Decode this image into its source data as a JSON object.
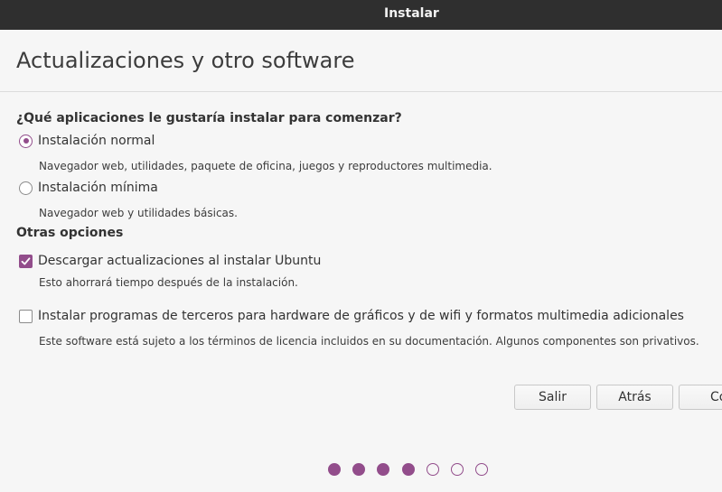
{
  "window": {
    "title": "Instalar"
  },
  "page": {
    "title": "Actualizaciones y otro software"
  },
  "apps_section": {
    "heading": "¿Qué aplicaciones le gustaría instalar para comenzar?",
    "options": [
      {
        "label": "Instalación normal",
        "description": "Navegador web, utilidades, paquete de oficina, juegos y reproductores multimedia.",
        "selected": true
      },
      {
        "label": "Instalación mínima",
        "description": "Navegador web y utilidades básicas.",
        "selected": false
      }
    ]
  },
  "other_section": {
    "heading": "Otras opciones",
    "options": [
      {
        "label": "Descargar actualizaciones al instalar Ubuntu",
        "description": "Esto ahorrará tiempo después de la instalación.",
        "checked": true
      },
      {
        "label": "Instalar programas de terceros para hardware de gráficos y de wifi y formatos multimedia adicionales",
        "description": "Este software está sujeto a los términos de licencia incluidos en su documentación. Algunos componentes son privativos.",
        "checked": false
      }
    ]
  },
  "buttons": {
    "quit": "Salir",
    "back": "Atrás",
    "continue": "Continuar"
  },
  "progress": {
    "total_steps": 7,
    "completed_steps": 4
  },
  "colors": {
    "accent": "#924d8b",
    "titlebar": "#2f2f2f"
  }
}
